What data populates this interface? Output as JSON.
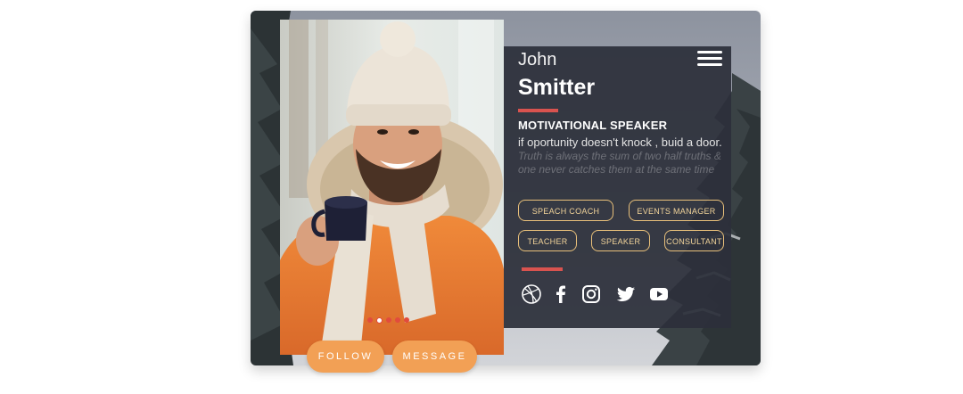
{
  "profile": {
    "first_name": "John",
    "last_name": "Smitter",
    "role": "MOTIVATIONAL SPEAKER",
    "quote": "if oportunity doesn't knock , buid a door.",
    "quote_faded": "Truth is always the sum of two half truths & one never catches them at the same time"
  },
  "tags": [
    "SPEACH COACH",
    "EVENTS MANAGER",
    "TEACHER",
    "SPEAKER",
    "CONSULTANT"
  ],
  "social_icons": [
    "dribbble-icon",
    "facebook-icon",
    "instagram-icon",
    "twitter-icon",
    "youtube-icon"
  ],
  "carousel": {
    "dot_count": 5,
    "active_index": 1
  },
  "buttons": {
    "follow": "FOLLOW",
    "message": "MESSAGE"
  },
  "colors": {
    "panel": "#2c2f3a",
    "accent_red": "#d9534f",
    "tag_border": "#e9c07a",
    "button": "#f2a055"
  }
}
